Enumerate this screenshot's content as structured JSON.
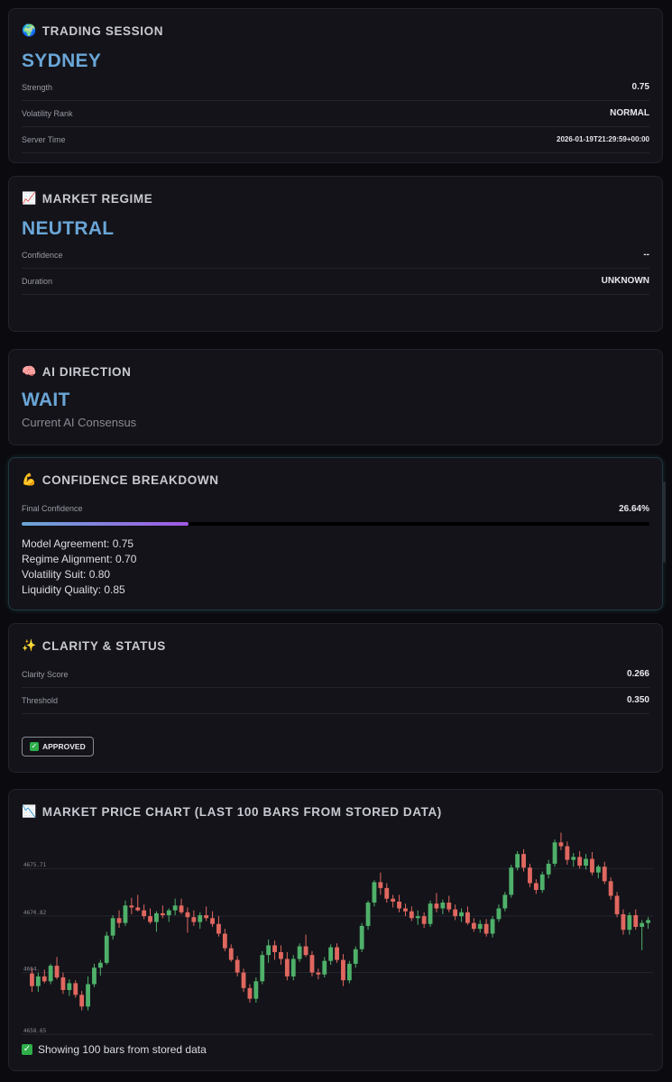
{
  "session": {
    "title": "TRADING SESSION",
    "icon": "globe-icon",
    "value": "SYDNEY",
    "rows": [
      {
        "label": "Strength",
        "value": "0.75"
      },
      {
        "label": "Volatility Rank",
        "value": "NORMAL"
      },
      {
        "label": "Server Time",
        "value": "2026-01-19T21:29:59+00:00"
      }
    ]
  },
  "regime": {
    "title": "MARKET REGIME",
    "icon": "chart-increasing-icon",
    "value": "NEUTRAL",
    "rows": [
      {
        "label": "Confidence",
        "value": "--"
      },
      {
        "label": "Duration",
        "value": "UNKNOWN"
      }
    ]
  },
  "direction": {
    "title": "AI DIRECTION",
    "icon": "brain-icon",
    "value": "WAIT",
    "subtitle": "Current AI Consensus"
  },
  "confidence": {
    "title": "CONFIDENCE BREAKDOWN",
    "icon": "flexed-biceps-icon",
    "final_label": "Final Confidence",
    "final_value": "26.64%",
    "final_fraction": 0.2664,
    "metrics": [
      "Model Agreement: 0.75",
      "Regime Alignment: 0.70",
      "Volatility Suit: 0.80",
      "Liquidity Quality: 0.85"
    ]
  },
  "clarity": {
    "title": "CLARITY & STATUS",
    "icon": "sparkles-icon",
    "rows": [
      {
        "label": "Clarity Score",
        "value": "0.266"
      },
      {
        "label": "Threshold",
        "value": "0.350"
      }
    ],
    "badge": "APPROVED",
    "badge_icon": "check-mark-icon"
  },
  "chart_card": {
    "title": "MARKET PRICE CHART (LAST 100 BARS FROM STORED DATA)",
    "icon": "chart-decreasing-icon",
    "footer": "Showing 100 bars from stored data",
    "footer_icon": "check-mark-icon"
  },
  "colors": {
    "accent": "#6aa6d6",
    "up": "#4fb06a",
    "down": "#e0675f",
    "progress_start": "#6aa6d6",
    "progress_end": "#a259e6"
  },
  "chart_data": {
    "type": "candlestick",
    "ylim": [
      4658.65,
      4680
    ],
    "y_ticks": [
      "4675.71",
      "4670.82",
      "4664.",
      "4658.65"
    ],
    "y_tick_values": [
      4675.71,
      4670.82,
      4665.0,
      4658.65
    ],
    "grid": true,
    "bars": 100,
    "ohlc": [
      [
        4664.9,
        4665.4,
        4663.0,
        4663.6
      ],
      [
        4663.6,
        4665.0,
        4663.0,
        4664.6
      ],
      [
        4664.6,
        4665.3,
        4663.9,
        4664.1
      ],
      [
        4664.1,
        4665.9,
        4663.8,
        4665.7
      ],
      [
        4665.7,
        4666.6,
        4664.3,
        4664.5
      ],
      [
        4664.5,
        4665.0,
        4662.8,
        4663.2
      ],
      [
        4663.2,
        4664.3,
        4662.6,
        4663.9
      ],
      [
        4663.9,
        4664.2,
        4662.4,
        4662.7
      ],
      [
        4662.7,
        4663.1,
        4661.1,
        4661.5
      ],
      [
        4661.5,
        4664.6,
        4661.1,
        4663.8
      ],
      [
        4663.8,
        4665.9,
        4663.5,
        4665.5
      ],
      [
        4665.5,
        4666.3,
        4664.7,
        4666.0
      ],
      [
        4666.0,
        4669.2,
        4665.8,
        4668.8
      ],
      [
        4668.8,
        4670.9,
        4668.4,
        4670.6
      ],
      [
        4670.6,
        4671.4,
        4669.6,
        4670.1
      ],
      [
        4670.1,
        4672.4,
        4669.8,
        4671.9
      ],
      [
        4671.9,
        4672.7,
        4671.0,
        4671.7
      ],
      [
        4671.7,
        4673.0,
        4671.3,
        4671.4
      ],
      [
        4671.4,
        4672.0,
        4670.5,
        4670.8
      ],
      [
        4670.8,
        4671.6,
        4670.0,
        4670.2
      ],
      [
        4670.2,
        4671.3,
        4669.2,
        4671.1
      ],
      [
        4671.1,
        4671.9,
        4670.6,
        4670.9
      ],
      [
        4670.9,
        4671.6,
        4670.2,
        4671.4
      ],
      [
        4671.4,
        4672.6,
        4670.9,
        4671.9
      ],
      [
        4671.9,
        4672.6,
        4671.0,
        4671.2
      ],
      [
        4671.2,
        4671.7,
        4669.1,
        4670.7
      ],
      [
        4670.7,
        4671.4,
        4669.8,
        4670.2
      ],
      [
        4670.2,
        4671.2,
        4669.5,
        4670.9
      ],
      [
        4670.9,
        4671.8,
        4670.3,
        4670.6
      ],
      [
        4670.6,
        4671.3,
        4669.7,
        4670.0
      ],
      [
        4670.0,
        4670.8,
        4668.7,
        4669.0
      ],
      [
        4669.0,
        4669.5,
        4667.2,
        4667.5
      ],
      [
        4667.5,
        4667.9,
        4666.1,
        4666.3
      ],
      [
        4666.3,
        4666.7,
        4664.6,
        4665.0
      ],
      [
        4665.0,
        4665.4,
        4663.0,
        4663.4
      ],
      [
        4663.4,
        4663.8,
        4661.9,
        4662.3
      ],
      [
        4662.3,
        4664.5,
        4661.9,
        4664.1
      ],
      [
        4664.1,
        4667.2,
        4663.8,
        4666.8
      ],
      [
        4666.8,
        4668.4,
        4666.0,
        4667.8
      ],
      [
        4667.8,
        4668.3,
        4666.3,
        4667.1
      ],
      [
        4667.1,
        4667.8,
        4665.8,
        4666.4
      ],
      [
        4666.4,
        4667.1,
        4664.2,
        4664.6
      ],
      [
        4664.6,
        4666.8,
        4664.2,
        4666.4
      ],
      [
        4666.4,
        4668.0,
        4666.1,
        4667.7
      ],
      [
        4667.7,
        4668.9,
        4666.6,
        4666.8
      ],
      [
        4666.8,
        4667.2,
        4664.6,
        4665.0
      ],
      [
        4665.0,
        4665.4,
        4664.3,
        4664.8
      ],
      [
        4664.8,
        4666.6,
        4664.5,
        4666.2
      ],
      [
        4666.2,
        4667.9,
        4665.8,
        4667.6
      ],
      [
        4667.6,
        4668.0,
        4666.0,
        4666.3
      ],
      [
        4666.3,
        4666.9,
        4663.6,
        4664.2
      ],
      [
        4664.2,
        4666.2,
        4663.9,
        4665.9
      ],
      [
        4665.9,
        4667.7,
        4665.5,
        4667.4
      ],
      [
        4667.4,
        4670.1,
        4667.1,
        4669.8
      ],
      [
        4669.8,
        4672.4,
        4669.4,
        4672.2
      ],
      [
        4672.2,
        4674.5,
        4671.8,
        4674.3
      ],
      [
        4674.3,
        4675.3,
        4673.0,
        4673.7
      ],
      [
        4673.7,
        4674.2,
        4672.2,
        4672.6
      ],
      [
        4672.6,
        4673.0,
        4671.7,
        4672.3
      ],
      [
        4672.3,
        4673.0,
        4671.2,
        4671.6
      ],
      [
        4671.6,
        4672.1,
        4670.8,
        4671.3
      ],
      [
        4671.3,
        4671.8,
        4670.3,
        4670.6
      ],
      [
        4670.6,
        4671.4,
        4669.9,
        4670.8
      ],
      [
        4670.8,
        4671.2,
        4669.6,
        4670.0
      ],
      [
        4670.0,
        4672.4,
        4669.7,
        4672.1
      ],
      [
        4672.1,
        4673.2,
        4671.2,
        4671.6
      ],
      [
        4671.6,
        4672.5,
        4671.0,
        4672.2
      ],
      [
        4672.2,
        4672.9,
        4671.2,
        4671.5
      ],
      [
        4671.5,
        4672.0,
        4670.4,
        4670.8
      ],
      [
        4670.8,
        4671.6,
        4670.2,
        4671.2
      ],
      [
        4671.2,
        4671.8,
        4669.9,
        4670.1
      ],
      [
        4670.1,
        4670.6,
        4669.2,
        4669.5
      ],
      [
        4669.5,
        4670.4,
        4669.1,
        4670.0
      ],
      [
        4670.0,
        4670.5,
        4668.7,
        4669.0
      ],
      [
        4669.0,
        4670.8,
        4668.6,
        4670.5
      ],
      [
        4670.5,
        4672.0,
        4670.2,
        4671.6
      ],
      [
        4671.6,
        4673.3,
        4671.3,
        4673.0
      ],
      [
        4673.0,
        4676.1,
        4672.7,
        4675.8
      ],
      [
        4675.8,
        4677.5,
        4675.5,
        4677.2
      ],
      [
        4677.2,
        4677.7,
        4675.4,
        4675.8
      ],
      [
        4675.8,
        4676.2,
        4673.8,
        4674.2
      ],
      [
        4674.2,
        4674.6,
        4673.1,
        4673.5
      ],
      [
        4673.5,
        4675.4,
        4673.2,
        4675.1
      ],
      [
        4675.1,
        4676.6,
        4674.7,
        4676.2
      ],
      [
        4676.2,
        4678.7,
        4675.9,
        4678.4
      ],
      [
        4678.4,
        4679.4,
        4677.6,
        4678.0
      ],
      [
        4678.0,
        4678.5,
        4676.1,
        4676.6
      ],
      [
        4676.6,
        4677.3,
        4675.9,
        4676.9
      ],
      [
        4676.9,
        4677.5,
        4675.7,
        4676.0
      ],
      [
        4676.0,
        4677.2,
        4675.6,
        4676.7
      ],
      [
        4676.7,
        4677.4,
        4675.0,
        4675.3
      ],
      [
        4675.3,
        4676.1,
        4674.7,
        4675.9
      ],
      [
        4675.9,
        4676.4,
        4674.1,
        4674.4
      ],
      [
        4674.4,
        4674.8,
        4672.5,
        4672.9
      ],
      [
        4672.9,
        4673.3,
        4670.7,
        4671.0
      ],
      [
        4671.0,
        4671.5,
        4668.9,
        4669.4
      ],
      [
        4669.4,
        4671.2,
        4668.9,
        4670.9
      ],
      [
        4670.9,
        4671.5,
        4669.4,
        4669.7
      ],
      [
        4669.7,
        4670.4,
        4667.3,
        4670.1
      ],
      [
        4670.1,
        4670.7,
        4669.5,
        4670.4
      ]
    ]
  }
}
